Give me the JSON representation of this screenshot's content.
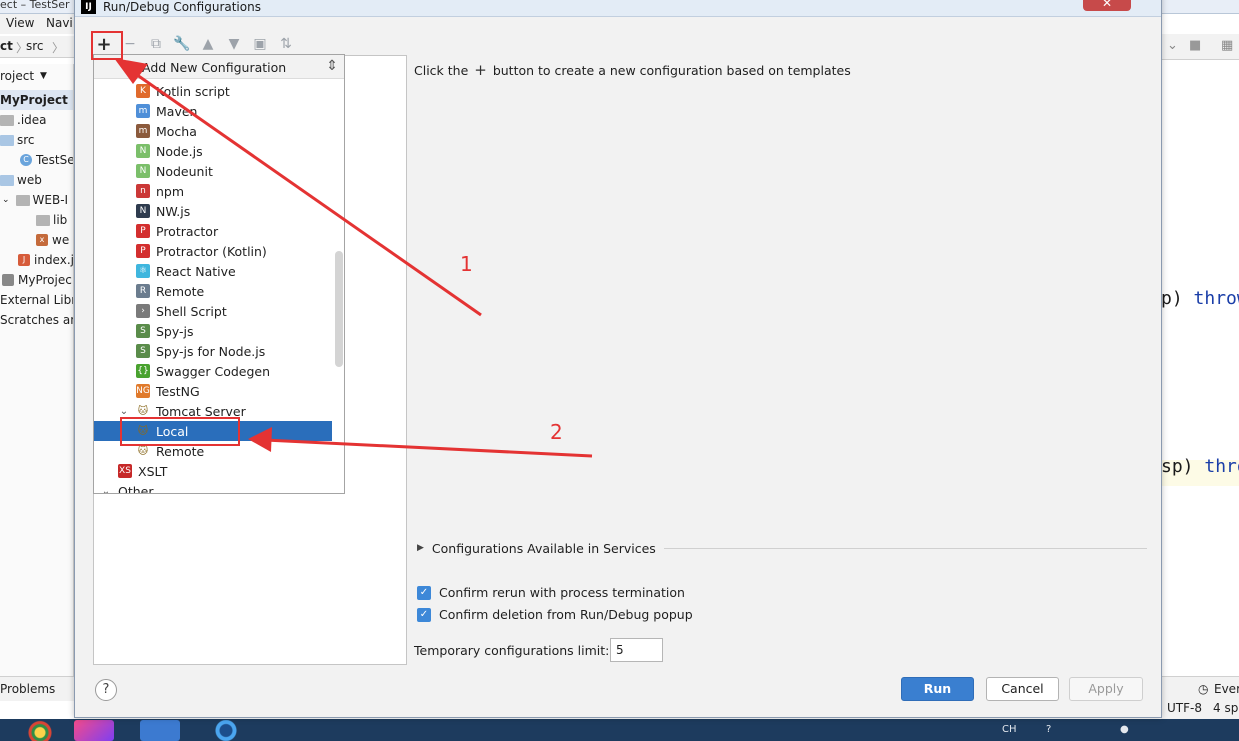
{
  "ide": {
    "title_fragment": "ect – TestSer",
    "menu": [
      "View",
      "Navi"
    ],
    "breadcrumb": [
      "ct",
      "src"
    ],
    "project_label": "roject",
    "tree": [
      {
        "label": "MyProject",
        "bold": true
      },
      {
        "label": ".idea"
      },
      {
        "label": "src"
      },
      {
        "label": "TestSe"
      },
      {
        "label": "web"
      },
      {
        "label": "WEB-I"
      },
      {
        "label": "lib"
      },
      {
        "label": "we"
      },
      {
        "label": "index.j"
      },
      {
        "label": "MyProjec"
      },
      {
        "label": "External Libr"
      },
      {
        "label": "Scratches an"
      }
    ],
    "code_lines": [
      {
        "pre": "p) ",
        "kw": "throw"
      },
      {
        "pre": "sp) ",
        "kw": "thro"
      }
    ],
    "bottom_tabs": {
      "problems": "Problems",
      "event": "Ever"
    },
    "status": {
      "encoding": "UTF-8",
      "indent": "4 sp"
    },
    "tray": {
      "lang": "CH"
    }
  },
  "dialog": {
    "title": "Run/Debug Configurations",
    "close": "✕",
    "toolbar": {
      "add": "+",
      "remove": "−",
      "copy": "⧉",
      "edit": "🔧",
      "up": "▲",
      "down": "▼",
      "folder": "▣",
      "sort": "⇅"
    },
    "popup": {
      "title": "Add New Configuration",
      "items": [
        {
          "label": "Kotlin script",
          "icon": "K",
          "color": "#e06a2c"
        },
        {
          "label": "Maven",
          "icon": "m",
          "color": "#4f8fd8"
        },
        {
          "label": "Mocha",
          "icon": "m",
          "color": "#8b5a3c"
        },
        {
          "label": "Node.js",
          "icon": "N",
          "color": "#7bbf6a"
        },
        {
          "label": "Nodeunit",
          "icon": "N",
          "color": "#7bbf6a"
        },
        {
          "label": "npm",
          "icon": "n",
          "color": "#cb3837"
        },
        {
          "label": "NW.js",
          "icon": "N",
          "color": "#2e3b4e"
        },
        {
          "label": "Protractor",
          "icon": "P",
          "color": "#d32f2f"
        },
        {
          "label": "Protractor (Kotlin)",
          "icon": "P",
          "color": "#d32f2f"
        },
        {
          "label": "React Native",
          "icon": "⚛",
          "color": "#3fb6de"
        },
        {
          "label": "Remote",
          "icon": "R",
          "color": "#6b7c8e"
        },
        {
          "label": "Shell Script",
          "icon": "›",
          "color": "#7a7a7a"
        },
        {
          "label": "Spy-js",
          "icon": "S",
          "color": "#5a8c4a"
        },
        {
          "label": "Spy-js for Node.js",
          "icon": "S",
          "color": "#5a8c4a"
        },
        {
          "label": "Swagger Codegen",
          "icon": "{}",
          "color": "#49a22f"
        },
        {
          "label": "TestNG",
          "icon": "NG",
          "color": "#e07a2c"
        }
      ],
      "tomcat": {
        "label": "Tomcat Server",
        "expanded_icon": "⌄"
      },
      "tomcat_children": [
        {
          "label": "Local"
        },
        {
          "label": "Remote"
        }
      ],
      "after": [
        {
          "label": "XSLT",
          "icon": "XS",
          "color": "#c62828"
        }
      ],
      "other": {
        "label": "Other"
      }
    },
    "hint": {
      "before": "Click the",
      "plus": "+",
      "after": "button to create a new configuration based on templates"
    },
    "services_label": "Configurations Available in Services",
    "checkbox_1": "Confirm rerun with process termination",
    "checkbox_2": "Confirm deletion from Run/Debug popup",
    "limit_label": "Temporary configurations limit:",
    "limit_value": "5",
    "help": "?",
    "buttons": {
      "run": "Run",
      "cancel": "Cancel",
      "apply": "Apply"
    }
  },
  "annotations": {
    "label_1": "1",
    "label_2": "2",
    "color": "#e43333"
  }
}
